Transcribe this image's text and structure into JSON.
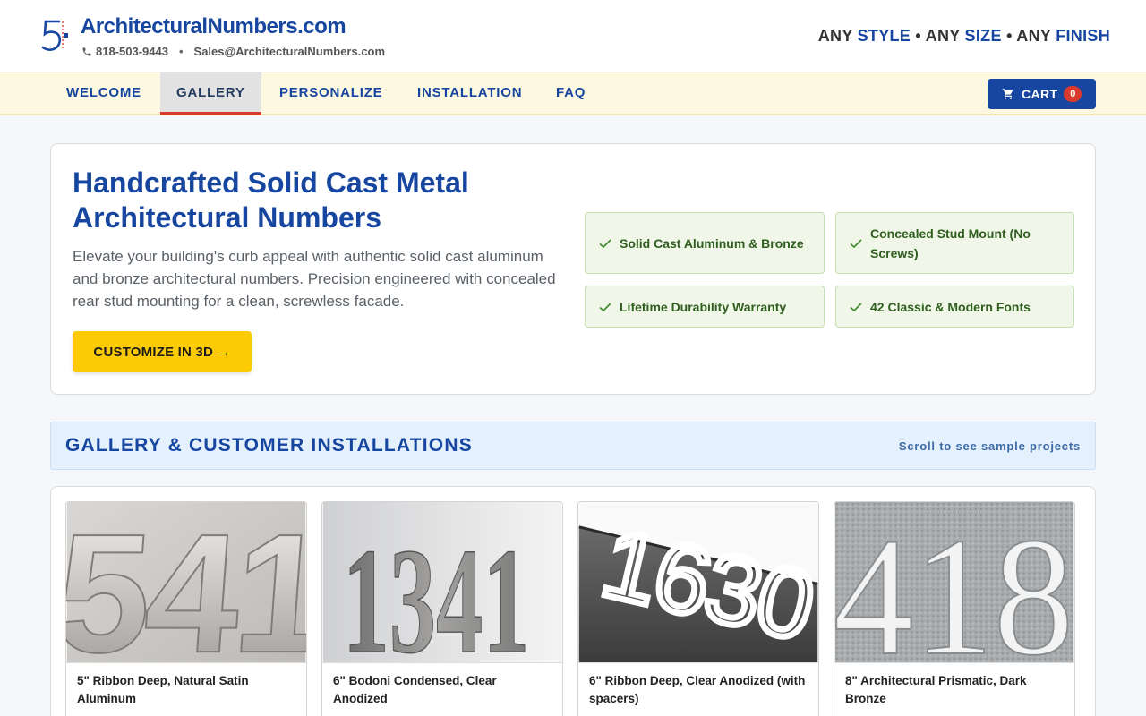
{
  "header": {
    "site_title": "ArchitecturalNumbers.com",
    "phone": "818-503-9443",
    "separator": "•",
    "email": "Sales@ArchitecturalNumbers.com",
    "tagline": [
      {
        "prefix": "ANY ",
        "highlight": "STYLE"
      },
      {
        "prefix": " • ANY ",
        "highlight": "SIZE"
      },
      {
        "prefix": " • ANY ",
        "highlight": "FINISH"
      }
    ],
    "logo_icon": "number-5-logo-icon"
  },
  "nav": {
    "items": [
      {
        "label": "WELCOME",
        "active": false
      },
      {
        "label": "GALLERY",
        "active": true
      },
      {
        "label": "PERSONALIZE",
        "active": false
      },
      {
        "label": "INSTALLATION",
        "active": false
      },
      {
        "label": "FAQ",
        "active": false
      }
    ],
    "cart_label": "CART",
    "cart_count": "0"
  },
  "hero": {
    "title": "Handcrafted Solid Cast Metal Architectural Numbers",
    "description": "Elevate your building's curb appeal with authentic solid cast aluminum and bronze architectural numbers. Precision engineered with concealed rear stud mounting for a clean, screwless facade.",
    "cta_label": "CUSTOMIZE IN 3D →",
    "features": [
      "Solid Cast Aluminum & Bronze",
      "Concealed Stud Mount (No Screws)",
      "Lifetime Durability Warranty",
      "42 Classic & Modern Fonts"
    ]
  },
  "gallery": {
    "title": "GALLERY & CUSTOMER INSTALLATIONS",
    "hint": "Scroll to see sample projects",
    "items": [
      {
        "caption": "5\" Ribbon Deep, Natural Satin Aluminum",
        "photo_digits": "541"
      },
      {
        "caption": "6\" Bodoni Condensed, Clear Anodized",
        "photo_digits": "1341"
      },
      {
        "caption": "6\" Ribbon Deep, Clear Anodized (with spacers)",
        "photo_digits": "1630"
      },
      {
        "caption": "8\" Architectural Prismatic, Dark Bronze",
        "photo_digits": "418"
      }
    ]
  },
  "colors": {
    "brand_blue": "#1646a0",
    "accent_yellow": "#fccb06",
    "cart_badge_red": "#d93a2b",
    "feature_green": "#2f5e1f"
  }
}
